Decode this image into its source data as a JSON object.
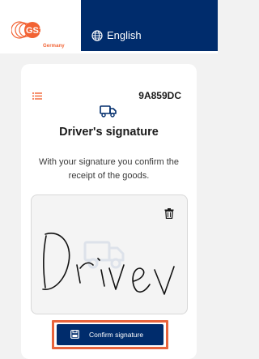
{
  "header": {
    "logo_text": "GS1",
    "logo_subtext": "Germany",
    "language": "English",
    "colors": {
      "navy": "#002c6c",
      "orange": "#f26334"
    }
  },
  "card": {
    "order_code": "9A859DC",
    "title": "Driver's signature",
    "description": "With your signature you confirm the receipt of the goods.",
    "signature_text": "Driver",
    "confirm_label": "Confirm signature"
  },
  "icons": [
    "gs1-logo",
    "globe-icon",
    "menu-icon",
    "truck-icon",
    "trash-icon",
    "save-icon"
  ]
}
